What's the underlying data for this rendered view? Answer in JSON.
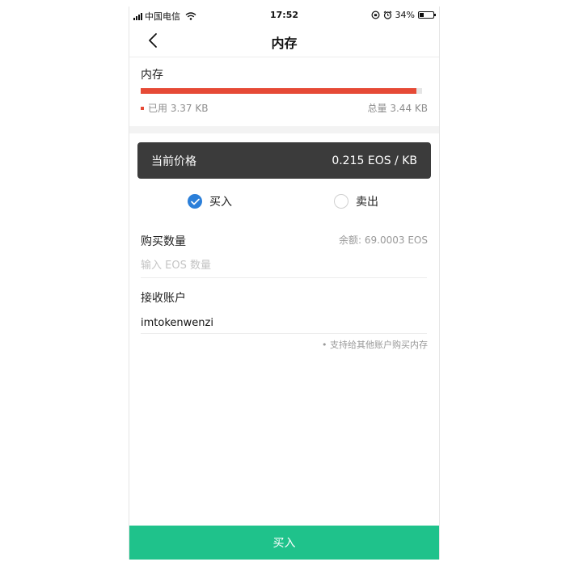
{
  "status_bar": {
    "carrier": "中国电信",
    "time": "17:52",
    "battery": "34%",
    "battery_level": 0.34
  },
  "nav": {
    "title": "内存"
  },
  "memory": {
    "title": "内存",
    "used_label": "已用 3.37 KB",
    "total_label": "总量 3.44 KB",
    "used_fraction": 0.98
  },
  "price": {
    "label": "当前价格",
    "value": "0.215 EOS / KB"
  },
  "trade": {
    "buy_label": "买入",
    "sell_label": "卖出",
    "selected": "buy"
  },
  "form": {
    "amount_label": "购买数量",
    "balance": "余额: 69.0003 EOS",
    "amount_placeholder": "输入 EOS 数量",
    "amount_value": "",
    "account_label": "接收账户",
    "account_value": "imtokenwenzi",
    "hint": "• 支持给其他账户购买内存"
  },
  "submit": {
    "label": "买入"
  },
  "colors": {
    "accent_red": "#e64a36",
    "accent_green": "#1fc28b",
    "accent_blue": "#2b7fd9",
    "price_bg": "#3b3b3b"
  }
}
